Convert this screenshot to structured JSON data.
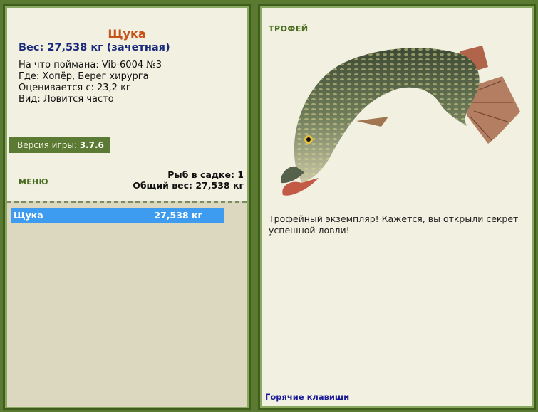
{
  "catch": {
    "title": "Щука",
    "weight_line": "Вес: 27,538 кг (зачетная)",
    "bait": "На что поймана: Vib-6004 №3",
    "location": "Где: Хопёр, Берег хирурга",
    "valued": "Оценивается с: 23,2 кг",
    "kind": "Вид: Ловится часто"
  },
  "version": {
    "label": "Версия игры:",
    "value": "3.7.6"
  },
  "menu": {
    "label": "МЕНЮ"
  },
  "keepnet": {
    "count_line": "Рыб в садке: 1",
    "total_line": "Общий вес: 27,538 кг",
    "rows": [
      {
        "name": "Щука",
        "weight": "27,538 кг"
      }
    ]
  },
  "trophy": {
    "label": "ТРОФЕЙ",
    "description": "Трофейный экземпляр! Кажется, вы открыли секрет успешной ловли!"
  },
  "footer": {
    "hotkeys": "Горячие клавиши"
  },
  "colors": {
    "accent_green": "#5b7a33",
    "selection_blue": "#3d9cf0",
    "title_orange": "#c8501a"
  }
}
